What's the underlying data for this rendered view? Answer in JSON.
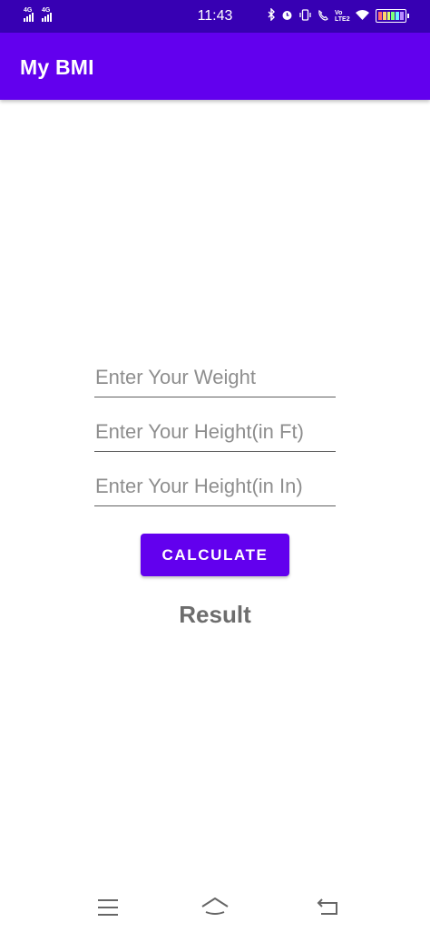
{
  "status_bar": {
    "sim1_label": "4G",
    "sim2_label": "4G",
    "time": "11:43",
    "volte_label": "Vo LTE2",
    "icons": [
      "bluetooth-icon",
      "alarm-icon",
      "vibrate-icon",
      "call-icon",
      "wifi-icon",
      "battery-icon"
    ]
  },
  "app_bar": {
    "title": "My BMI",
    "color": "#6200EE",
    "status_color": "#3700B3"
  },
  "form": {
    "weight_placeholder": "Enter Your Weight",
    "height_ft_placeholder": "Enter Your Height(in Ft)",
    "height_in_placeholder": "Enter Your Height(in In)",
    "calculate_label": "CALCULATE",
    "result_label": "Result"
  },
  "nav_bar": {
    "icons": [
      "menu-icon",
      "home-icon",
      "back-icon"
    ]
  }
}
